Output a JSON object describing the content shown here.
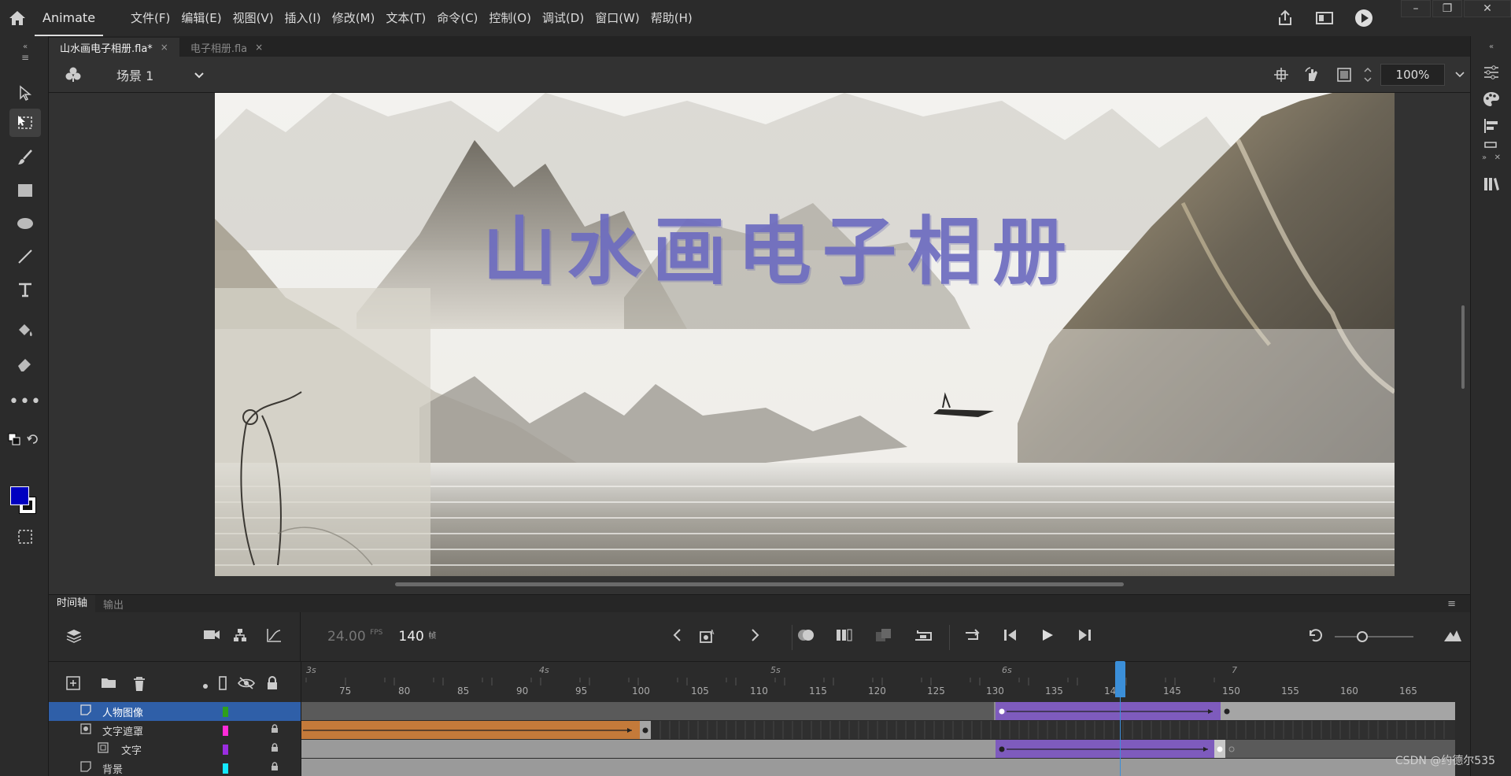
{
  "app": {
    "name": "Animate"
  },
  "menu": [
    "文件(F)",
    "编辑(E)",
    "视图(V)",
    "插入(I)",
    "修改(M)",
    "文本(T)",
    "命令(C)",
    "控制(O)",
    "调试(D)",
    "窗口(W)",
    "帮助(H)"
  ],
  "window_controls": [
    "–",
    "❐",
    "✕"
  ],
  "doc_tabs": [
    {
      "label": "山水画电子相册.fla*",
      "close": "×"
    },
    {
      "label": "电子相册.fla",
      "close": "×"
    }
  ],
  "editbar": {
    "scene": "场景 1",
    "zoom": "100%"
  },
  "stage": {
    "title": "山水画电子相册"
  },
  "colors": {
    "fill": "#0000c0",
    "stroke": "#ffffff",
    "selected_layer": "#2f5fa8",
    "playhead": "#3b8fd9",
    "tween": "#7e5bbd",
    "shape_tween": "#c47a3a"
  },
  "timeline": {
    "tabs": [
      "时间轴",
      "输出"
    ],
    "fps": "24.00",
    "fps_unit": "FPS",
    "frame": "140",
    "frame_unit": "帧",
    "seconds": [
      "3s",
      "4s",
      "5s",
      "6s",
      "7"
    ],
    "frame_numbers": [
      "75",
      "80",
      "85",
      "90",
      "95",
      "100",
      "105",
      "110",
      "115",
      "120",
      "125",
      "130",
      "135",
      "140",
      "145",
      "150",
      "155",
      "160",
      "165"
    ],
    "layers": [
      {
        "name": "人物图像",
        "color": "#2ea01c",
        "selected": true
      },
      {
        "name": "文字遮罩",
        "color": "#ff2bd9",
        "selected": false
      },
      {
        "name": "文字",
        "color": "#9b2de0",
        "selected": false
      },
      {
        "name": "背景",
        "color": "#14e8ff",
        "selected": false
      }
    ]
  },
  "watermark": "CSDN @约德尔535"
}
